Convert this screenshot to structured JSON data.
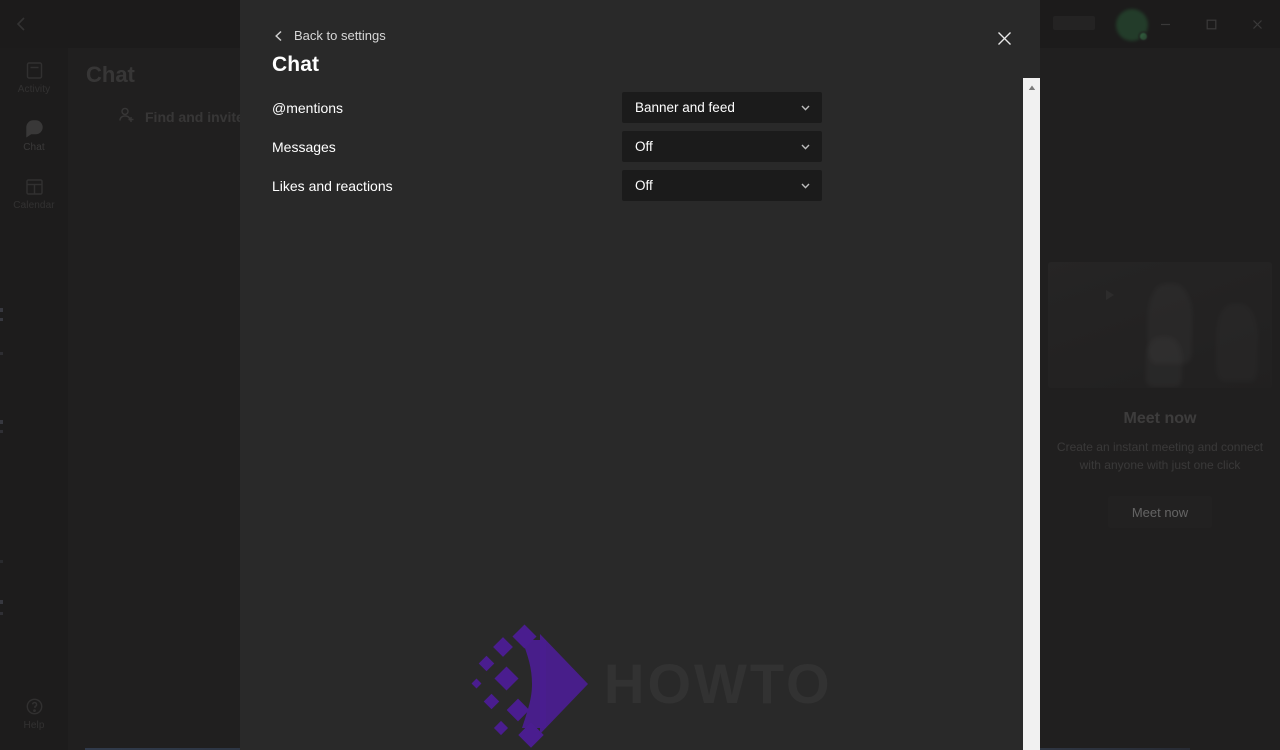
{
  "window": {
    "controls": [
      {
        "name": "minimize",
        "glyph": "minimize-icon"
      },
      {
        "name": "maximize",
        "glyph": "maximize-icon"
      },
      {
        "name": "close",
        "glyph": "close-icon"
      }
    ]
  },
  "background": {
    "rail": {
      "items": [
        {
          "label": "Activity",
          "icon": "activity-icon",
          "active": false
        },
        {
          "label": "Chat",
          "icon": "chat-bubble-icon",
          "active": true
        },
        {
          "label": "Calendar",
          "icon": "calendar-icon",
          "active": false
        }
      ],
      "bottom": {
        "label": "Help",
        "icon": "help-icon"
      }
    },
    "chat_column": {
      "title": "Chat",
      "menu_icon": "filter-menu-icon",
      "find_invite": {
        "label": "Find and invite",
        "icon": "add-person-icon"
      }
    },
    "meet_panel": {
      "title": "Meet now",
      "description": "Create an instant meeting and connect with anyone with just one click",
      "button_label": "Meet now"
    }
  },
  "modal": {
    "back_label": "Back to settings",
    "back_icon": "chevron-left-icon",
    "title": "Chat",
    "close_icon": "close-icon",
    "scrollbar": {
      "up_arrow_icon": "scroll-up-arrow-icon"
    },
    "settings": [
      {
        "label": "@mentions",
        "value": "Banner and feed",
        "chevron": "chevron-down-icon"
      },
      {
        "label": "Messages",
        "value": "Off",
        "chevron": "chevron-down-icon"
      },
      {
        "label": "Likes and reactions",
        "value": "Off",
        "chevron": "chevron-down-icon"
      }
    ]
  },
  "watermark": {
    "text": "HOWTO",
    "logo_color": "#4a1d8f"
  },
  "colors": {
    "modal_bg": "#292929",
    "dropdown_bg": "#1b1b1b",
    "app_bg": "#201f1f",
    "rail_bg": "#1d1c1c",
    "scrollbar": "#f1f1f1",
    "text_primary": "#ffffff",
    "text_secondary": "#d6d6d6"
  }
}
